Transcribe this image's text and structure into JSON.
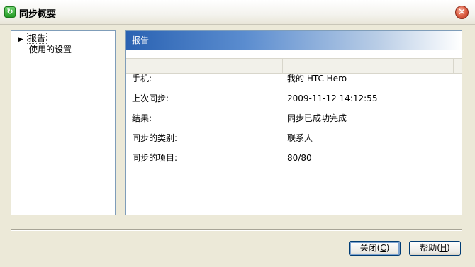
{
  "window": {
    "title": "同步概要"
  },
  "tree": {
    "items": [
      {
        "label": "报告",
        "selected": true
      },
      {
        "label": "使用的设置",
        "selected": false
      }
    ]
  },
  "panel": {
    "header": "报告",
    "rows": [
      {
        "key": "手机:",
        "value": "我的 HTC Hero"
      },
      {
        "key": "上次同步:",
        "value": "2009-11-12 14:12:55"
      },
      {
        "key": "结果:",
        "value": "同步已成功完成"
      },
      {
        "key": "同步的类别:",
        "value": "联系人"
      },
      {
        "key": "同步的项目:",
        "value": "80/80"
      }
    ]
  },
  "buttons": {
    "close_prefix": "关闭(",
    "close_key": "C",
    "close_suffix": ")",
    "help_prefix": "帮助(",
    "help_key": "H",
    "help_suffix": ")"
  },
  "colors": {
    "header_start": "#2a62b2",
    "accent_border": "#003c74"
  },
  "icons": {
    "app": "sync-icon",
    "close": "close-icon",
    "tree_expander": "triangle-right-icon"
  }
}
